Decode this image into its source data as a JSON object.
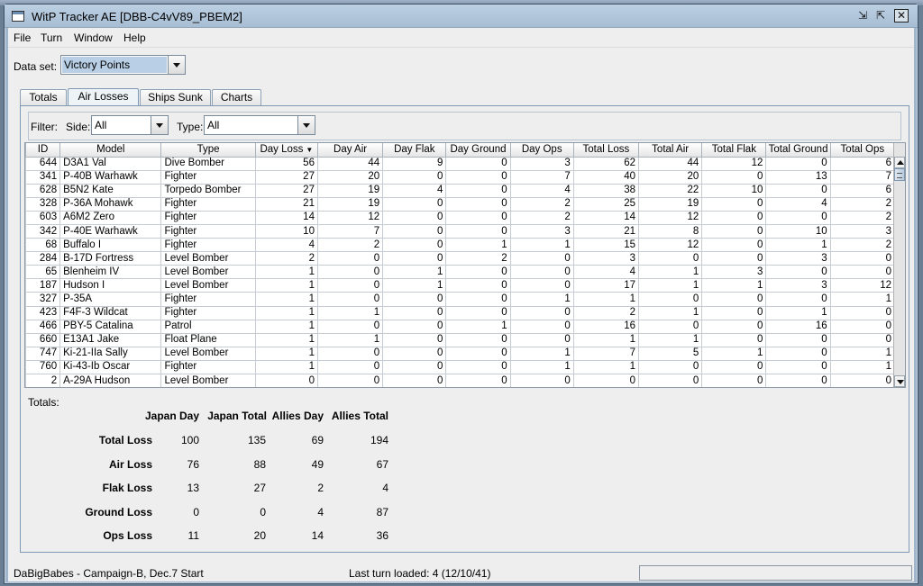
{
  "window": {
    "title": "WitP Tracker AE [DBB-C4vV89_PBEM2]",
    "minimize_glyph": "⇲",
    "restore_glyph": "⇱",
    "close_glyph": "✕"
  },
  "menu": [
    {
      "label": "File"
    },
    {
      "label": "Turn"
    },
    {
      "label": "Window"
    },
    {
      "label": "Help"
    }
  ],
  "dataset": {
    "label": "Data set:",
    "value": "Victory Points"
  },
  "tabs": [
    {
      "label": "Totals",
      "active": false
    },
    {
      "label": "Air Losses",
      "active": true
    },
    {
      "label": "Ships Sunk",
      "active": false
    },
    {
      "label": "Charts",
      "active": false
    }
  ],
  "filter": {
    "label": "Filter:",
    "side_label": "Side:",
    "side_value": "All",
    "type_label": "Type:",
    "type_value": "All"
  },
  "table": {
    "columns": [
      "ID",
      "Model",
      "Type",
      "Day Loss",
      "Day Air",
      "Day Flak",
      "Day Ground",
      "Day Ops",
      "Total Loss",
      "Total Air",
      "Total Flak",
      "Total Ground",
      "Total Ops"
    ],
    "sorted_column_index": 3,
    "rows": [
      [
        "644",
        "D3A1 Val",
        "Dive Bomber",
        "56",
        "44",
        "9",
        "0",
        "3",
        "62",
        "44",
        "12",
        "0",
        "6"
      ],
      [
        "341",
        "P-40B Warhawk",
        "Fighter",
        "27",
        "20",
        "0",
        "0",
        "7",
        "40",
        "20",
        "0",
        "13",
        "7"
      ],
      [
        "628",
        "B5N2 Kate",
        "Torpedo Bomber",
        "27",
        "19",
        "4",
        "0",
        "4",
        "38",
        "22",
        "10",
        "0",
        "6"
      ],
      [
        "328",
        "P-36A Mohawk",
        "Fighter",
        "21",
        "19",
        "0",
        "0",
        "2",
        "25",
        "19",
        "0",
        "4",
        "2"
      ],
      [
        "603",
        "A6M2 Zero",
        "Fighter",
        "14",
        "12",
        "0",
        "0",
        "2",
        "14",
        "12",
        "0",
        "0",
        "2"
      ],
      [
        "342",
        "P-40E Warhawk",
        "Fighter",
        "10",
        "7",
        "0",
        "0",
        "3",
        "21",
        "8",
        "0",
        "10",
        "3"
      ],
      [
        "68",
        "Buffalo I",
        "Fighter",
        "4",
        "2",
        "0",
        "1",
        "1",
        "15",
        "12",
        "0",
        "1",
        "2"
      ],
      [
        "284",
        "B-17D Fortress",
        "Level Bomber",
        "2",
        "0",
        "0",
        "2",
        "0",
        "3",
        "0",
        "0",
        "3",
        "0"
      ],
      [
        "65",
        "Blenheim IV",
        "Level Bomber",
        "1",
        "0",
        "1",
        "0",
        "0",
        "4",
        "1",
        "3",
        "0",
        "0"
      ],
      [
        "187",
        "Hudson I",
        "Level Bomber",
        "1",
        "0",
        "1",
        "0",
        "0",
        "17",
        "1",
        "1",
        "3",
        "12"
      ],
      [
        "327",
        "P-35A",
        "Fighter",
        "1",
        "0",
        "0",
        "0",
        "1",
        "1",
        "0",
        "0",
        "0",
        "1"
      ],
      [
        "423",
        "F4F-3 Wildcat",
        "Fighter",
        "1",
        "1",
        "0",
        "0",
        "0",
        "2",
        "1",
        "0",
        "1",
        "0"
      ],
      [
        "466",
        "PBY-5 Catalina",
        "Patrol",
        "1",
        "0",
        "0",
        "1",
        "0",
        "16",
        "0",
        "0",
        "16",
        "0"
      ],
      [
        "660",
        "E13A1 Jake",
        "Float Plane",
        "1",
        "1",
        "0",
        "0",
        "0",
        "1",
        "1",
        "0",
        "0",
        "0"
      ],
      [
        "747",
        "Ki-21-IIa Sally",
        "Level Bomber",
        "1",
        "0",
        "0",
        "0",
        "1",
        "7",
        "5",
        "1",
        "0",
        "1"
      ],
      [
        "760",
        "Ki-43-Ib Oscar",
        "Fighter",
        "1",
        "0",
        "0",
        "0",
        "1",
        "1",
        "0",
        "0",
        "0",
        "1"
      ],
      [
        "2",
        "A-29A Hudson",
        "Level Bomber",
        "0",
        "0",
        "0",
        "0",
        "0",
        "0",
        "0",
        "0",
        "0",
        "0"
      ]
    ]
  },
  "totals": {
    "heading": "Totals:",
    "columns": [
      "Japan Day",
      "Japan Total",
      "Allies Day",
      "Allies Total"
    ],
    "rows": [
      {
        "label": "Total Loss",
        "values": [
          "100",
          "135",
          "69",
          "194"
        ]
      },
      {
        "label": "Air Loss",
        "values": [
          "76",
          "88",
          "49",
          "67"
        ]
      },
      {
        "label": "Flak Loss",
        "values": [
          "13",
          "27",
          "2",
          "4"
        ]
      },
      {
        "label": "Ground Loss",
        "values": [
          "0",
          "0",
          "4",
          "87"
        ]
      },
      {
        "label": "Ops Loss",
        "values": [
          "11",
          "20",
          "14",
          "36"
        ]
      }
    ]
  },
  "status": {
    "left": "DaBigBabes - Campaign-B, Dec.7 Start",
    "middle": "Last turn loaded: 4 (12/10/41)"
  },
  "colors": {
    "desktop": "#6a7f94",
    "window_frame": "#9fb6cc",
    "client_bg": "#eeeeee",
    "selection": "#b8cfe5"
  }
}
